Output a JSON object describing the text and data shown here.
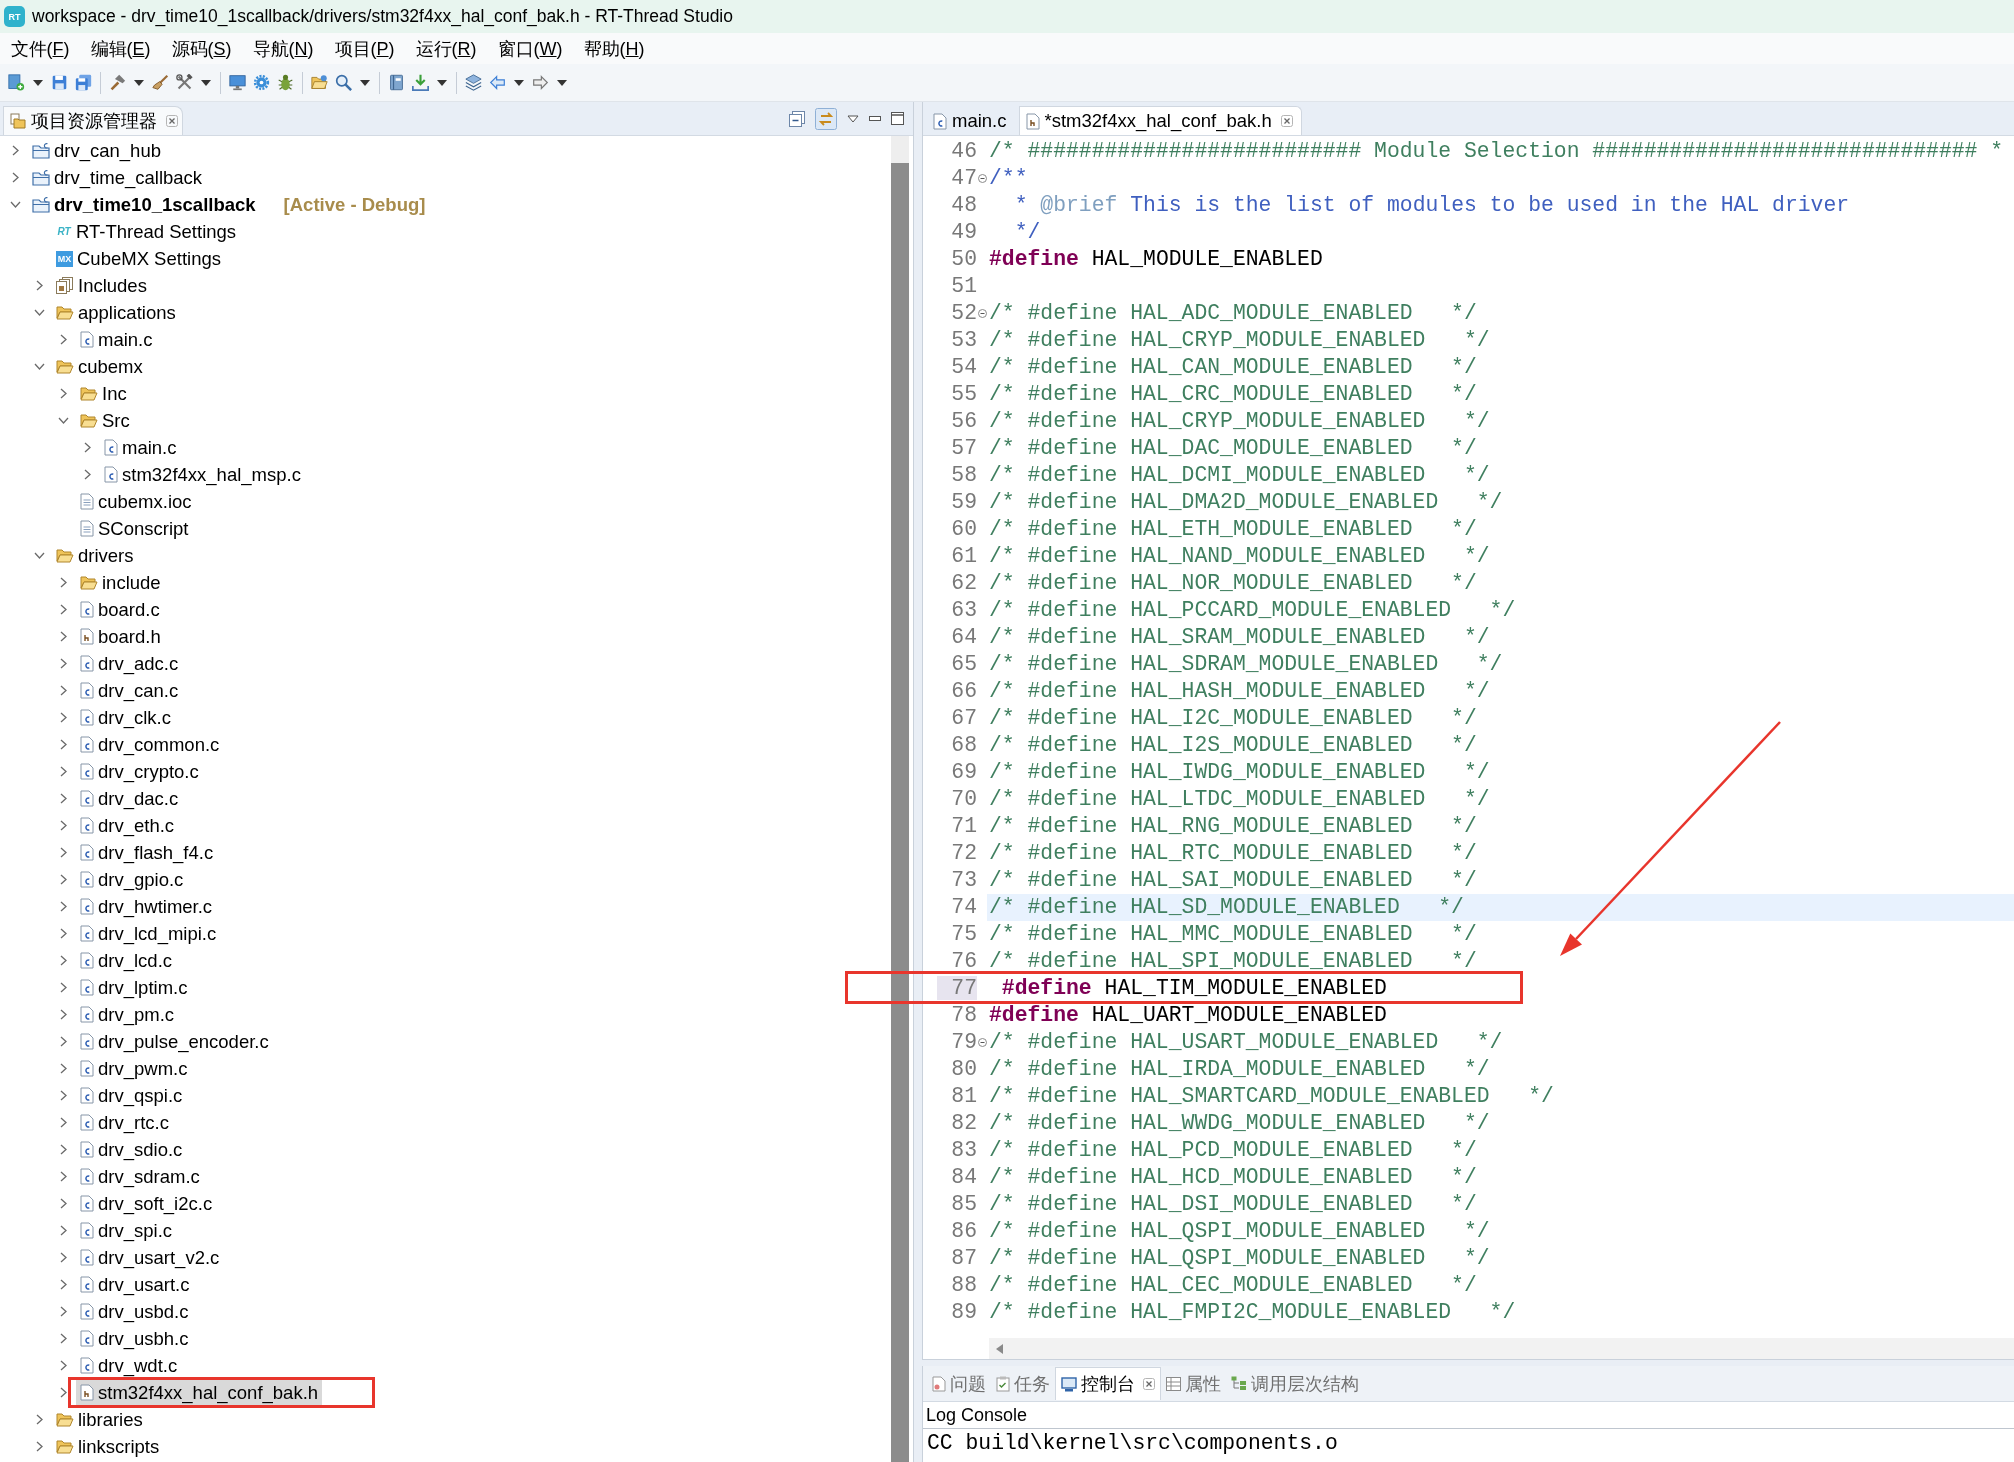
{
  "window": {
    "logo": "RT",
    "title": "workspace - drv_time10_1scallback/drivers/stm32f4xx_hal_conf_bak.h - RT-Thread Studio"
  },
  "menu": [
    "文件(F)",
    "编辑(E)",
    "源码(S)",
    "导航(N)",
    "项目(P)",
    "运行(R)",
    "窗口(W)",
    "帮助(H)"
  ],
  "explorer": {
    "title": "项目资源管理器",
    "tree": [
      {
        "label": "drv_can_hub",
        "kind": "project",
        "expanded": false,
        "selected": false,
        "active": false,
        "marked": false
      },
      {
        "label": "drv_time_callback",
        "kind": "project",
        "expanded": false,
        "selected": false,
        "active": false,
        "marked": false
      },
      {
        "label": "drv_time10_1scallback",
        "kind": "project",
        "expanded": true,
        "selected": false,
        "active": true,
        "status": "[Active - Debug]",
        "marked": false,
        "children": [
          {
            "label": "RT-Thread Settings",
            "kind": "rt-settings",
            "badge": "RT",
            "selected": false,
            "marked": false
          },
          {
            "label": "CubeMX Settings",
            "kind": "mx-settings",
            "badge": "MX",
            "selected": false,
            "marked": false
          },
          {
            "label": "Includes",
            "kind": "includes",
            "expanded": false,
            "selected": false,
            "marked": false
          },
          {
            "label": "applications",
            "kind": "folder",
            "expanded": true,
            "selected": false,
            "marked": false,
            "children": [
              {
                "label": "main.c",
                "kind": "c-file",
                "expanded": false,
                "selected": false,
                "marked": false
              }
            ]
          },
          {
            "label": "cubemx",
            "kind": "folder",
            "expanded": true,
            "selected": false,
            "marked": false,
            "children": [
              {
                "label": "Inc",
                "kind": "folder",
                "expanded": false,
                "selected": false,
                "marked": false
              },
              {
                "label": "Src",
                "kind": "folder",
                "expanded": true,
                "selected": false,
                "marked": false,
                "children": [
                  {
                    "label": "main.c",
                    "kind": "c-file",
                    "expanded": false,
                    "selected": false,
                    "marked": false
                  },
                  {
                    "label": "stm32f4xx_hal_msp.c",
                    "kind": "c-file",
                    "expanded": false,
                    "selected": false,
                    "marked": false
                  }
                ]
              },
              {
                "label": "cubemx.ioc",
                "kind": "file",
                "selected": false,
                "marked": false
              },
              {
                "label": "SConscript",
                "kind": "file",
                "selected": false,
                "marked": false
              }
            ]
          },
          {
            "label": "drivers",
            "kind": "folder",
            "expanded": true,
            "selected": false,
            "marked": false,
            "children": [
              {
                "label": "include",
                "kind": "folder",
                "expanded": false,
                "selected": false,
                "marked": false
              },
              {
                "label": "board.c",
                "kind": "c-file",
                "expanded": false,
                "selected": false,
                "marked": false
              },
              {
                "label": "board.h",
                "kind": "h-file",
                "expanded": false,
                "selected": false,
                "marked": false
              },
              {
                "label": "drv_adc.c",
                "kind": "c-file",
                "expanded": false,
                "selected": false,
                "marked": false
              },
              {
                "label": "drv_can.c",
                "kind": "c-file",
                "expanded": false,
                "selected": false,
                "marked": false
              },
              {
                "label": "drv_clk.c",
                "kind": "c-file",
                "expanded": false,
                "selected": false,
                "marked": false
              },
              {
                "label": "drv_common.c",
                "kind": "c-file",
                "expanded": false,
                "selected": false,
                "marked": false
              },
              {
                "label": "drv_crypto.c",
                "kind": "c-file",
                "expanded": false,
                "selected": false,
                "marked": false
              },
              {
                "label": "drv_dac.c",
                "kind": "c-file",
                "expanded": false,
                "selected": false,
                "marked": false
              },
              {
                "label": "drv_eth.c",
                "kind": "c-file",
                "expanded": false,
                "selected": false,
                "marked": false
              },
              {
                "label": "drv_flash_f4.c",
                "kind": "c-file",
                "expanded": false,
                "selected": false,
                "marked": false
              },
              {
                "label": "drv_gpio.c",
                "kind": "c-file",
                "expanded": false,
                "selected": false,
                "marked": false
              },
              {
                "label": "drv_hwtimer.c",
                "kind": "c-file",
                "expanded": false,
                "selected": false,
                "marked": false
              },
              {
                "label": "drv_lcd_mipi.c",
                "kind": "c-file",
                "expanded": false,
                "selected": false,
                "marked": false
              },
              {
                "label": "drv_lcd.c",
                "kind": "c-file",
                "expanded": false,
                "selected": false,
                "marked": false
              },
              {
                "label": "drv_lptim.c",
                "kind": "c-file",
                "expanded": false,
                "selected": false,
                "marked": false
              },
              {
                "label": "drv_pm.c",
                "kind": "c-file",
                "expanded": false,
                "selected": false,
                "marked": false
              },
              {
                "label": "drv_pulse_encoder.c",
                "kind": "c-file",
                "expanded": false,
                "selected": false,
                "marked": false
              },
              {
                "label": "drv_pwm.c",
                "kind": "c-file",
                "expanded": false,
                "selected": false,
                "marked": false
              },
              {
                "label": "drv_qspi.c",
                "kind": "c-file",
                "expanded": false,
                "selected": false,
                "marked": false
              },
              {
                "label": "drv_rtc.c",
                "kind": "c-file",
                "expanded": false,
                "selected": false,
                "marked": false
              },
              {
                "label": "drv_sdio.c",
                "kind": "c-file",
                "expanded": false,
                "selected": false,
                "marked": false
              },
              {
                "label": "drv_sdram.c",
                "kind": "c-file",
                "expanded": false,
                "selected": false,
                "marked": false
              },
              {
                "label": "drv_soft_i2c.c",
                "kind": "c-file",
                "expanded": false,
                "selected": false,
                "marked": false
              },
              {
                "label": "drv_spi.c",
                "kind": "c-file",
                "expanded": false,
                "selected": false,
                "marked": false
              },
              {
                "label": "drv_usart_v2.c",
                "kind": "c-file",
                "expanded": false,
                "selected": false,
                "marked": false
              },
              {
                "label": "drv_usart.c",
                "kind": "c-file",
                "expanded": false,
                "selected": false,
                "marked": false
              },
              {
                "label": "drv_usbd.c",
                "kind": "c-file",
                "expanded": false,
                "selected": false,
                "marked": false
              },
              {
                "label": "drv_usbh.c",
                "kind": "c-file",
                "expanded": false,
                "selected": false,
                "marked": false
              },
              {
                "label": "drv_wdt.c",
                "kind": "c-file",
                "expanded": false,
                "selected": false,
                "marked": false
              },
              {
                "label": "stm32f4xx_hal_conf_bak.h",
                "kind": "h-file",
                "expanded": false,
                "selected": true,
                "marked": true
              }
            ]
          },
          {
            "label": "libraries",
            "kind": "folder",
            "expanded": false,
            "selected": false,
            "marked": false
          },
          {
            "label": "linkscripts",
            "kind": "folder",
            "expanded": false,
            "selected": false,
            "marked": false
          }
        ]
      }
    ]
  },
  "editor": {
    "tabs": [
      {
        "label": "main.c",
        "kind": "c-file",
        "selected": false
      },
      {
        "label": "*stm32f4xx_hal_conf_bak.h",
        "kind": "h-file",
        "selected": true
      }
    ],
    "lines": [
      {
        "number": "46",
        "fold": false,
        "current": false,
        "number_highlighted": false,
        "marked": false,
        "tokens": [
          {
            "kind": "comment",
            "text": "/* ########################## Module Selection ############################## *"
          }
        ]
      },
      {
        "number": "47",
        "fold": true,
        "current": false,
        "number_highlighted": false,
        "marked": false,
        "tokens": [
          {
            "kind": "doc",
            "text": "/**"
          }
        ]
      },
      {
        "number": "48",
        "fold": false,
        "current": false,
        "number_highlighted": false,
        "marked": false,
        "tokens": [
          {
            "kind": "doc",
            "text": "  * "
          },
          {
            "kind": "doc-tag",
            "text": "@brief"
          },
          {
            "kind": "doc",
            "text": " This is the list of modules to be used in the HAL driver"
          }
        ]
      },
      {
        "number": "49",
        "fold": false,
        "current": false,
        "number_highlighted": false,
        "marked": false,
        "tokens": [
          {
            "kind": "doc",
            "text": "  */"
          }
        ]
      },
      {
        "number": "50",
        "fold": false,
        "current": false,
        "number_highlighted": false,
        "marked": false,
        "tokens": [
          {
            "kind": "keyword",
            "text": "#define"
          },
          {
            "kind": "plain",
            "text": " HAL_MODULE_ENABLED"
          }
        ]
      },
      {
        "number": "51",
        "fold": false,
        "current": false,
        "number_highlighted": false,
        "marked": false
      },
      {
        "number": "52",
        "fold": true,
        "current": false,
        "number_highlighted": false,
        "marked": false,
        "tokens": [
          {
            "kind": "comment",
            "text": "/* #define HAL_ADC_MODULE_ENABLED   */"
          }
        ]
      },
      {
        "number": "53",
        "fold": false,
        "current": false,
        "number_highlighted": false,
        "marked": false,
        "tokens": [
          {
            "kind": "comment",
            "text": "/* #define HAL_CRYP_MODULE_ENABLED   */"
          }
        ]
      },
      {
        "number": "54",
        "fold": false,
        "current": false,
        "number_highlighted": false,
        "marked": false,
        "tokens": [
          {
            "kind": "comment",
            "text": "/* #define HAL_CAN_MODULE_ENABLED   */"
          }
        ]
      },
      {
        "number": "55",
        "fold": false,
        "current": false,
        "number_highlighted": false,
        "marked": false,
        "tokens": [
          {
            "kind": "comment",
            "text": "/* #define HAL_CRC_MODULE_ENABLED   */"
          }
        ]
      },
      {
        "number": "56",
        "fold": false,
        "current": false,
        "number_highlighted": false,
        "marked": false,
        "tokens": [
          {
            "kind": "comment",
            "text": "/* #define HAL_CRYP_MODULE_ENABLED   */"
          }
        ]
      },
      {
        "number": "57",
        "fold": false,
        "current": false,
        "number_highlighted": false,
        "marked": false,
        "tokens": [
          {
            "kind": "comment",
            "text": "/* #define HAL_DAC_MODULE_ENABLED   */"
          }
        ]
      },
      {
        "number": "58",
        "fold": false,
        "current": false,
        "number_highlighted": false,
        "marked": false,
        "tokens": [
          {
            "kind": "comment",
            "text": "/* #define HAL_DCMI_MODULE_ENABLED   */"
          }
        ]
      },
      {
        "number": "59",
        "fold": false,
        "current": false,
        "number_highlighted": false,
        "marked": false,
        "tokens": [
          {
            "kind": "comment",
            "text": "/* #define HAL_DMA2D_MODULE_ENABLED   */"
          }
        ]
      },
      {
        "number": "60",
        "fold": false,
        "current": false,
        "number_highlighted": false,
        "marked": false,
        "tokens": [
          {
            "kind": "comment",
            "text": "/* #define HAL_ETH_MODULE_ENABLED   */"
          }
        ]
      },
      {
        "number": "61",
        "fold": false,
        "current": false,
        "number_highlighted": false,
        "marked": false,
        "tokens": [
          {
            "kind": "comment",
            "text": "/* #define HAL_NAND_MODULE_ENABLED   */"
          }
        ]
      },
      {
        "number": "62",
        "fold": false,
        "current": false,
        "number_highlighted": false,
        "marked": false,
        "tokens": [
          {
            "kind": "comment",
            "text": "/* #define HAL_NOR_MODULE_ENABLED   */"
          }
        ]
      },
      {
        "number": "63",
        "fold": false,
        "current": false,
        "number_highlighted": false,
        "marked": false,
        "tokens": [
          {
            "kind": "comment",
            "text": "/* #define HAL_PCCARD_MODULE_ENABLED   */"
          }
        ]
      },
      {
        "number": "64",
        "fold": false,
        "current": false,
        "number_highlighted": false,
        "marked": false,
        "tokens": [
          {
            "kind": "comment",
            "text": "/* #define HAL_SRAM_MODULE_ENABLED   */"
          }
        ]
      },
      {
        "number": "65",
        "fold": false,
        "current": false,
        "number_highlighted": false,
        "marked": false,
        "tokens": [
          {
            "kind": "comment",
            "text": "/* #define HAL_SDRAM_MODULE_ENABLED   */"
          }
        ]
      },
      {
        "number": "66",
        "fold": false,
        "current": false,
        "number_highlighted": false,
        "marked": false,
        "tokens": [
          {
            "kind": "comment",
            "text": "/* #define HAL_HASH_MODULE_ENABLED   */"
          }
        ]
      },
      {
        "number": "67",
        "fold": false,
        "current": false,
        "number_highlighted": false,
        "marked": false,
        "tokens": [
          {
            "kind": "comment",
            "text": "/* #define HAL_I2C_MODULE_ENABLED   */"
          }
        ]
      },
      {
        "number": "68",
        "fold": false,
        "current": false,
        "number_highlighted": false,
        "marked": false,
        "tokens": [
          {
            "kind": "comment",
            "text": "/* #define HAL_I2S_MODULE_ENABLED   */"
          }
        ]
      },
      {
        "number": "69",
        "fold": false,
        "current": false,
        "number_highlighted": false,
        "marked": false,
        "tokens": [
          {
            "kind": "comment",
            "text": "/* #define HAL_IWDG_MODULE_ENABLED   */"
          }
        ]
      },
      {
        "number": "70",
        "fold": false,
        "current": false,
        "number_highlighted": false,
        "marked": false,
        "tokens": [
          {
            "kind": "comment",
            "text": "/* #define HAL_LTDC_MODULE_ENABLED   */"
          }
        ]
      },
      {
        "number": "71",
        "fold": false,
        "current": false,
        "number_highlighted": false,
        "marked": false,
        "tokens": [
          {
            "kind": "comment",
            "text": "/* #define HAL_RNG_MODULE_ENABLED   */"
          }
        ]
      },
      {
        "number": "72",
        "fold": false,
        "current": false,
        "number_highlighted": false,
        "marked": false,
        "tokens": [
          {
            "kind": "comment",
            "text": "/* #define HAL_RTC_MODULE_ENABLED   */"
          }
        ]
      },
      {
        "number": "73",
        "fold": false,
        "current": false,
        "number_highlighted": false,
        "marked": false,
        "tokens": [
          {
            "kind": "comment",
            "text": "/* #define HAL_SAI_MODULE_ENABLED   */"
          }
        ]
      },
      {
        "number": "74",
        "fold": false,
        "current": true,
        "number_highlighted": false,
        "marked": false,
        "tokens": [
          {
            "kind": "comment",
            "text": "/* #define HAL_SD_MODULE_ENABLED   */"
          }
        ]
      },
      {
        "number": "75",
        "fold": false,
        "current": false,
        "number_highlighted": false,
        "marked": false,
        "tokens": [
          {
            "kind": "comment",
            "text": "/* #define HAL_MMC_MODULE_ENABLED   */"
          }
        ]
      },
      {
        "number": "76",
        "fold": false,
        "current": false,
        "number_highlighted": false,
        "marked": false,
        "tokens": [
          {
            "kind": "comment",
            "text": "/* #define HAL_SPI_MODULE_ENABLED   */"
          }
        ]
      },
      {
        "number": "77",
        "fold": false,
        "current": false,
        "number_highlighted": true,
        "marked": true,
        "tokens": [
          {
            "kind": "keyword",
            "text": " #define"
          },
          {
            "kind": "plain",
            "text": " HAL_TIM_MODULE_ENABLED"
          }
        ]
      },
      {
        "number": "78",
        "fold": false,
        "current": false,
        "number_highlighted": false,
        "marked": false,
        "tokens": [
          {
            "kind": "keyword",
            "text": "#define"
          },
          {
            "kind": "plain",
            "text": " HAL_UART_MODULE_ENABLED"
          }
        ]
      },
      {
        "number": "79",
        "fold": true,
        "current": false,
        "number_highlighted": false,
        "marked": false,
        "tokens": [
          {
            "kind": "comment",
            "text": "/* #define HAL_USART_MODULE_ENABLED   */"
          }
        ]
      },
      {
        "number": "80",
        "fold": false,
        "current": false,
        "number_highlighted": false,
        "marked": false,
        "tokens": [
          {
            "kind": "comment",
            "text": "/* #define HAL_IRDA_MODULE_ENABLED   */"
          }
        ]
      },
      {
        "number": "81",
        "fold": false,
        "current": false,
        "number_highlighted": false,
        "marked": false,
        "tokens": [
          {
            "kind": "comment",
            "text": "/* #define HAL_SMARTCARD_MODULE_ENABLED   */"
          }
        ]
      },
      {
        "number": "82",
        "fold": false,
        "current": false,
        "number_highlighted": false,
        "marked": false,
        "tokens": [
          {
            "kind": "comment",
            "text": "/* #define HAL_WWDG_MODULE_ENABLED   */"
          }
        ]
      },
      {
        "number": "83",
        "fold": false,
        "current": false,
        "number_highlighted": false,
        "marked": false,
        "tokens": [
          {
            "kind": "comment",
            "text": "/* #define HAL_PCD_MODULE_ENABLED   */"
          }
        ]
      },
      {
        "number": "84",
        "fold": false,
        "current": false,
        "number_highlighted": false,
        "marked": false,
        "tokens": [
          {
            "kind": "comment",
            "text": "/* #define HAL_HCD_MODULE_ENABLED   */"
          }
        ]
      },
      {
        "number": "85",
        "fold": false,
        "current": false,
        "number_highlighted": false,
        "marked": false,
        "tokens": [
          {
            "kind": "comment",
            "text": "/* #define HAL_DSI_MODULE_ENABLED   */"
          }
        ]
      },
      {
        "number": "86",
        "fold": false,
        "current": false,
        "number_highlighted": false,
        "marked": false,
        "tokens": [
          {
            "kind": "comment",
            "text": "/* #define HAL_QSPI_MODULE_ENABLED   */"
          }
        ]
      },
      {
        "number": "87",
        "fold": false,
        "current": false,
        "number_highlighted": false,
        "marked": false,
        "tokens": [
          {
            "kind": "comment",
            "text": "/* #define HAL_QSPI_MODULE_ENABLED   */"
          }
        ]
      },
      {
        "number": "88",
        "fold": false,
        "current": false,
        "number_highlighted": false,
        "marked": false,
        "tokens": [
          {
            "kind": "comment",
            "text": "/* #define HAL_CEC_MODULE_ENABLED   */"
          }
        ]
      },
      {
        "number": "89",
        "fold": false,
        "current": false,
        "number_highlighted": false,
        "marked": false,
        "tokens": [
          {
            "kind": "comment",
            "text": "/* #define HAL_FMPI2C_MODULE_ENABLED   */"
          }
        ]
      }
    ]
  },
  "bottom_panel": {
    "tabs": [
      {
        "label": "问题",
        "selected": false
      },
      {
        "label": "任务",
        "selected": false
      },
      {
        "label": "控制台",
        "selected": true
      },
      {
        "label": "属性",
        "selected": false
      },
      {
        "label": "调用层次结构",
        "selected": false
      }
    ],
    "console_title": "Log Console",
    "console_lines": [
      "CC build\\kernel\\src\\components.o"
    ]
  }
}
